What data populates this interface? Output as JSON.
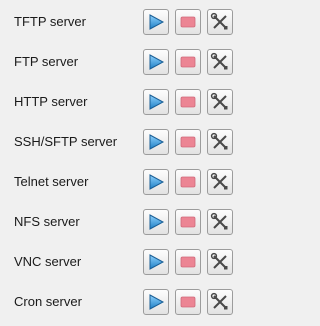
{
  "services": [
    {
      "label": "TFTP server"
    },
    {
      "label": "FTP server"
    },
    {
      "label": "HTTP server"
    },
    {
      "label": "SSH/SFTP server"
    },
    {
      "label": "Telnet server"
    },
    {
      "label": "NFS server"
    },
    {
      "label": "VNC server"
    },
    {
      "label": "Cron server"
    }
  ],
  "icons": {
    "start": "play-icon",
    "stop": "stop-icon",
    "settings": "tools-icon"
  },
  "colors": {
    "play": "#3aa0e0",
    "stop": "#e77a8a",
    "tools": "#555555"
  }
}
